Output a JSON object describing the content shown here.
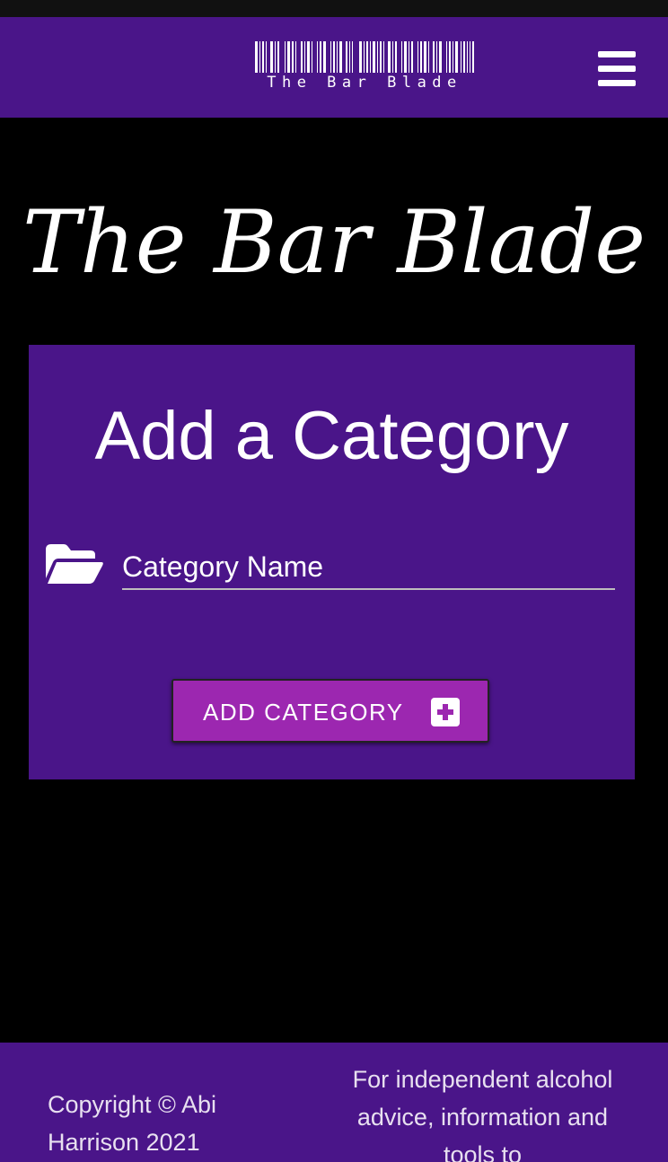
{
  "navbar": {
    "brand_text": "The Bar Blade",
    "menu_icon": "hamburger-menu-icon",
    "background": "#4a1589"
  },
  "hero": {
    "title": "The Bar Blade"
  },
  "card": {
    "title": "Add a Category",
    "folder_icon": "folder-open-icon",
    "category_field": {
      "placeholder": "Category Name",
      "value": ""
    },
    "add_button": {
      "label": "ADD CATEGORY",
      "icon": "plus-square-icon",
      "color": "#9c27b0"
    }
  },
  "footer": {
    "copyright": "Copyright © Abi Harrison 2021",
    "tagline": "For independent alcohol advice, information and tools to"
  }
}
